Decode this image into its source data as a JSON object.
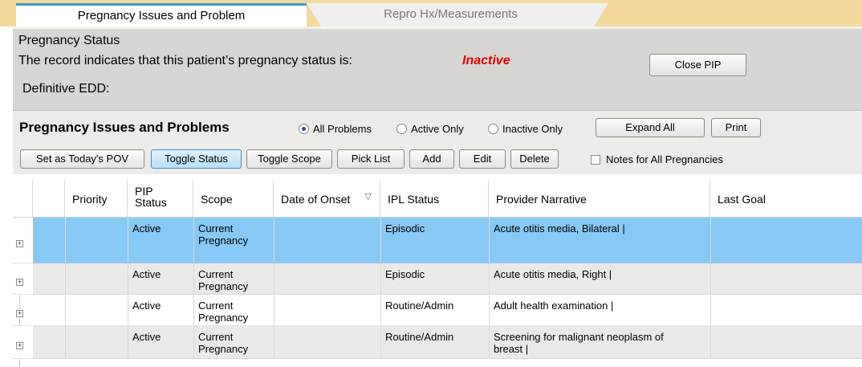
{
  "tabs": {
    "active": "Pregnancy Issues and Problem",
    "inactive": "Repro Hx/Measurements"
  },
  "status": {
    "title": "Pregnancy Status",
    "line": "The record indicates that this patient’s pregnancy status is:",
    "value": "Inactive",
    "value_color": "#e00000",
    "edd_label": "Definitive EDD:",
    "close_button": "Close PIP"
  },
  "problems": {
    "title": "Pregnancy Issues and Problems",
    "filters": [
      "All Problems",
      "Active Only",
      "Inactive Only"
    ],
    "selected_filter": "All Problems",
    "expand_all": "Expand All",
    "print": "Print",
    "actions": {
      "set_pov": "Set as Today's POV",
      "toggle_status": "Toggle Status",
      "toggle_scope": "Toggle Scope",
      "pick_list": "Pick List",
      "add": "Add",
      "edit": "Edit",
      "delete": "Delete"
    },
    "notes_checkbox": "Notes for All Pregnancies",
    "notes_checked": false
  },
  "grid": {
    "columns": {
      "priority": "Priority",
      "pip_status_1": "PIP",
      "pip_status_2": "Status",
      "scope": "Scope",
      "date_of_onset": "Date of Onset",
      "ipl_status": "IPL Status",
      "provider_narrative": "Provider Narrative",
      "last_goal": "Last Goal"
    },
    "rows": [
      {
        "priority": "",
        "pip_status": "Active",
        "scope_1": "Current",
        "scope_2": "Pregnancy",
        "date_of_onset": "",
        "ipl_status": "Episodic",
        "narrative_1": "Acute otitis media, Bilateral |",
        "narrative_2": "",
        "last_goal": "",
        "selected": true
      },
      {
        "priority": "",
        "pip_status": "Active",
        "scope_1": "Current",
        "scope_2": "Pregnancy",
        "date_of_onset": "",
        "ipl_status": "Episodic",
        "narrative_1": "Acute otitis media, Right |",
        "narrative_2": "",
        "last_goal": "",
        "selected": false
      },
      {
        "priority": "",
        "pip_status": "Active",
        "scope_1": "Current",
        "scope_2": "Pregnancy",
        "date_of_onset": "",
        "ipl_status": "Routine/Admin",
        "narrative_1": "Adult health examination |",
        "narrative_2": "",
        "last_goal": "",
        "selected": false
      },
      {
        "priority": "",
        "pip_status": "Active",
        "scope_1": "Current",
        "scope_2": "Pregnancy",
        "date_of_onset": "",
        "ipl_status": "Routine/Admin",
        "narrative_1": "Screening for malignant neoplasm of",
        "narrative_2": "breast |",
        "last_goal": "",
        "selected": false
      }
    ],
    "selected_row_color": "#87c8f5",
    "alt_row_color": "#e9e9e9"
  }
}
